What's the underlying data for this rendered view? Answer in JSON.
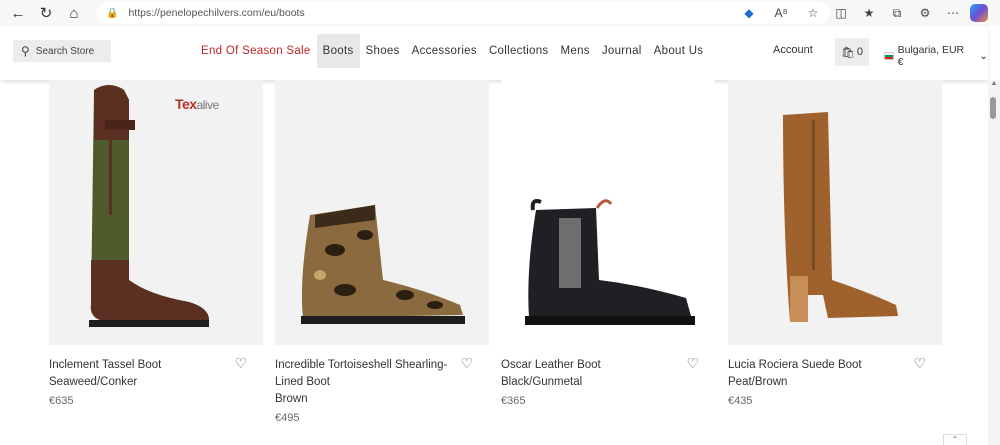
{
  "browser": {
    "url": "https://penelopechilvers.com/eu/boots"
  },
  "header": {
    "search_placeholder": "Search Store",
    "nav": [
      "End Of Season Sale",
      "Boots",
      "Shoes",
      "Accessories",
      "Collections",
      "Mens",
      "Journal",
      "About Us"
    ],
    "account_label": "Account",
    "bag_count": "0",
    "locale_label": "Bulgaria, EUR €"
  },
  "products": [
    {
      "name": "Inclement Tassel Boot",
      "color": "Seaweed/Conker",
      "price": "€635",
      "badge": "Texalive"
    },
    {
      "name": "Incredible Tortoiseshell Shearling-Lined Boot",
      "color": "Brown",
      "price": "€495"
    },
    {
      "name": "Oscar Leather Boot",
      "color": "Black/Gunmetal",
      "price": "€365"
    },
    {
      "name": "Lucia Rociera Suede Boot",
      "color": "Peat/Brown",
      "price": "€435"
    }
  ],
  "colors": {
    "sale": "#c0252a",
    "active_nav_bg": "#e8e8e8"
  }
}
